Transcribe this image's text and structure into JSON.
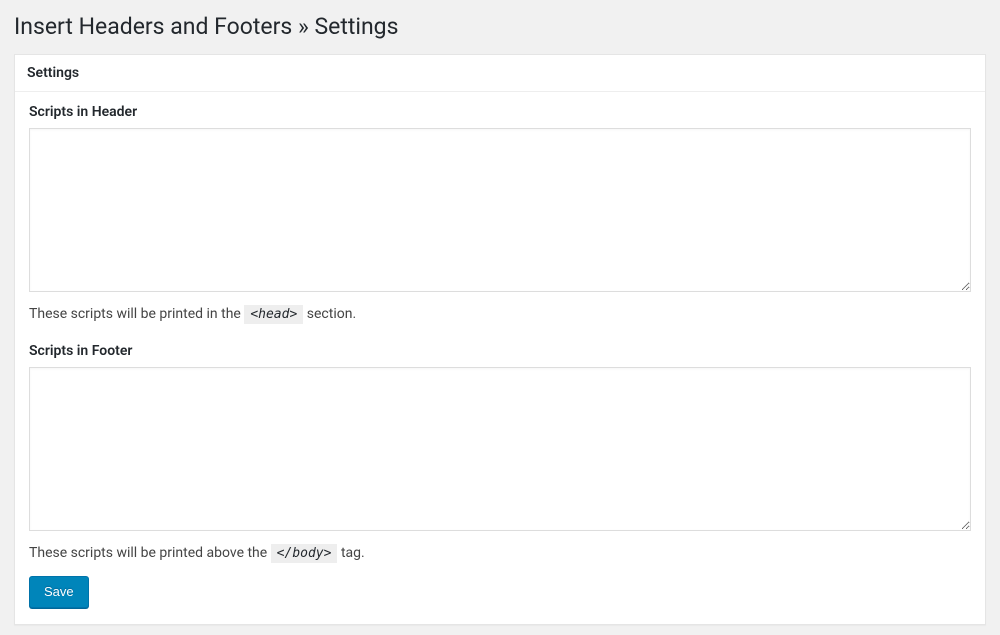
{
  "page": {
    "title_prefix": "Insert Headers and Footers",
    "title_separator": "»",
    "title_suffix": "Settings"
  },
  "panel": {
    "heading": "Settings"
  },
  "fields": {
    "header": {
      "label": "Scripts in Header",
      "value": "",
      "description_prefix": "These scripts will be printed in the ",
      "description_code": "<head>",
      "description_suffix": " section."
    },
    "footer": {
      "label": "Scripts in Footer",
      "value": "",
      "description_prefix": "These scripts will be printed above the ",
      "description_code": "</body>",
      "description_suffix": " tag."
    }
  },
  "actions": {
    "save_label": "Save"
  }
}
